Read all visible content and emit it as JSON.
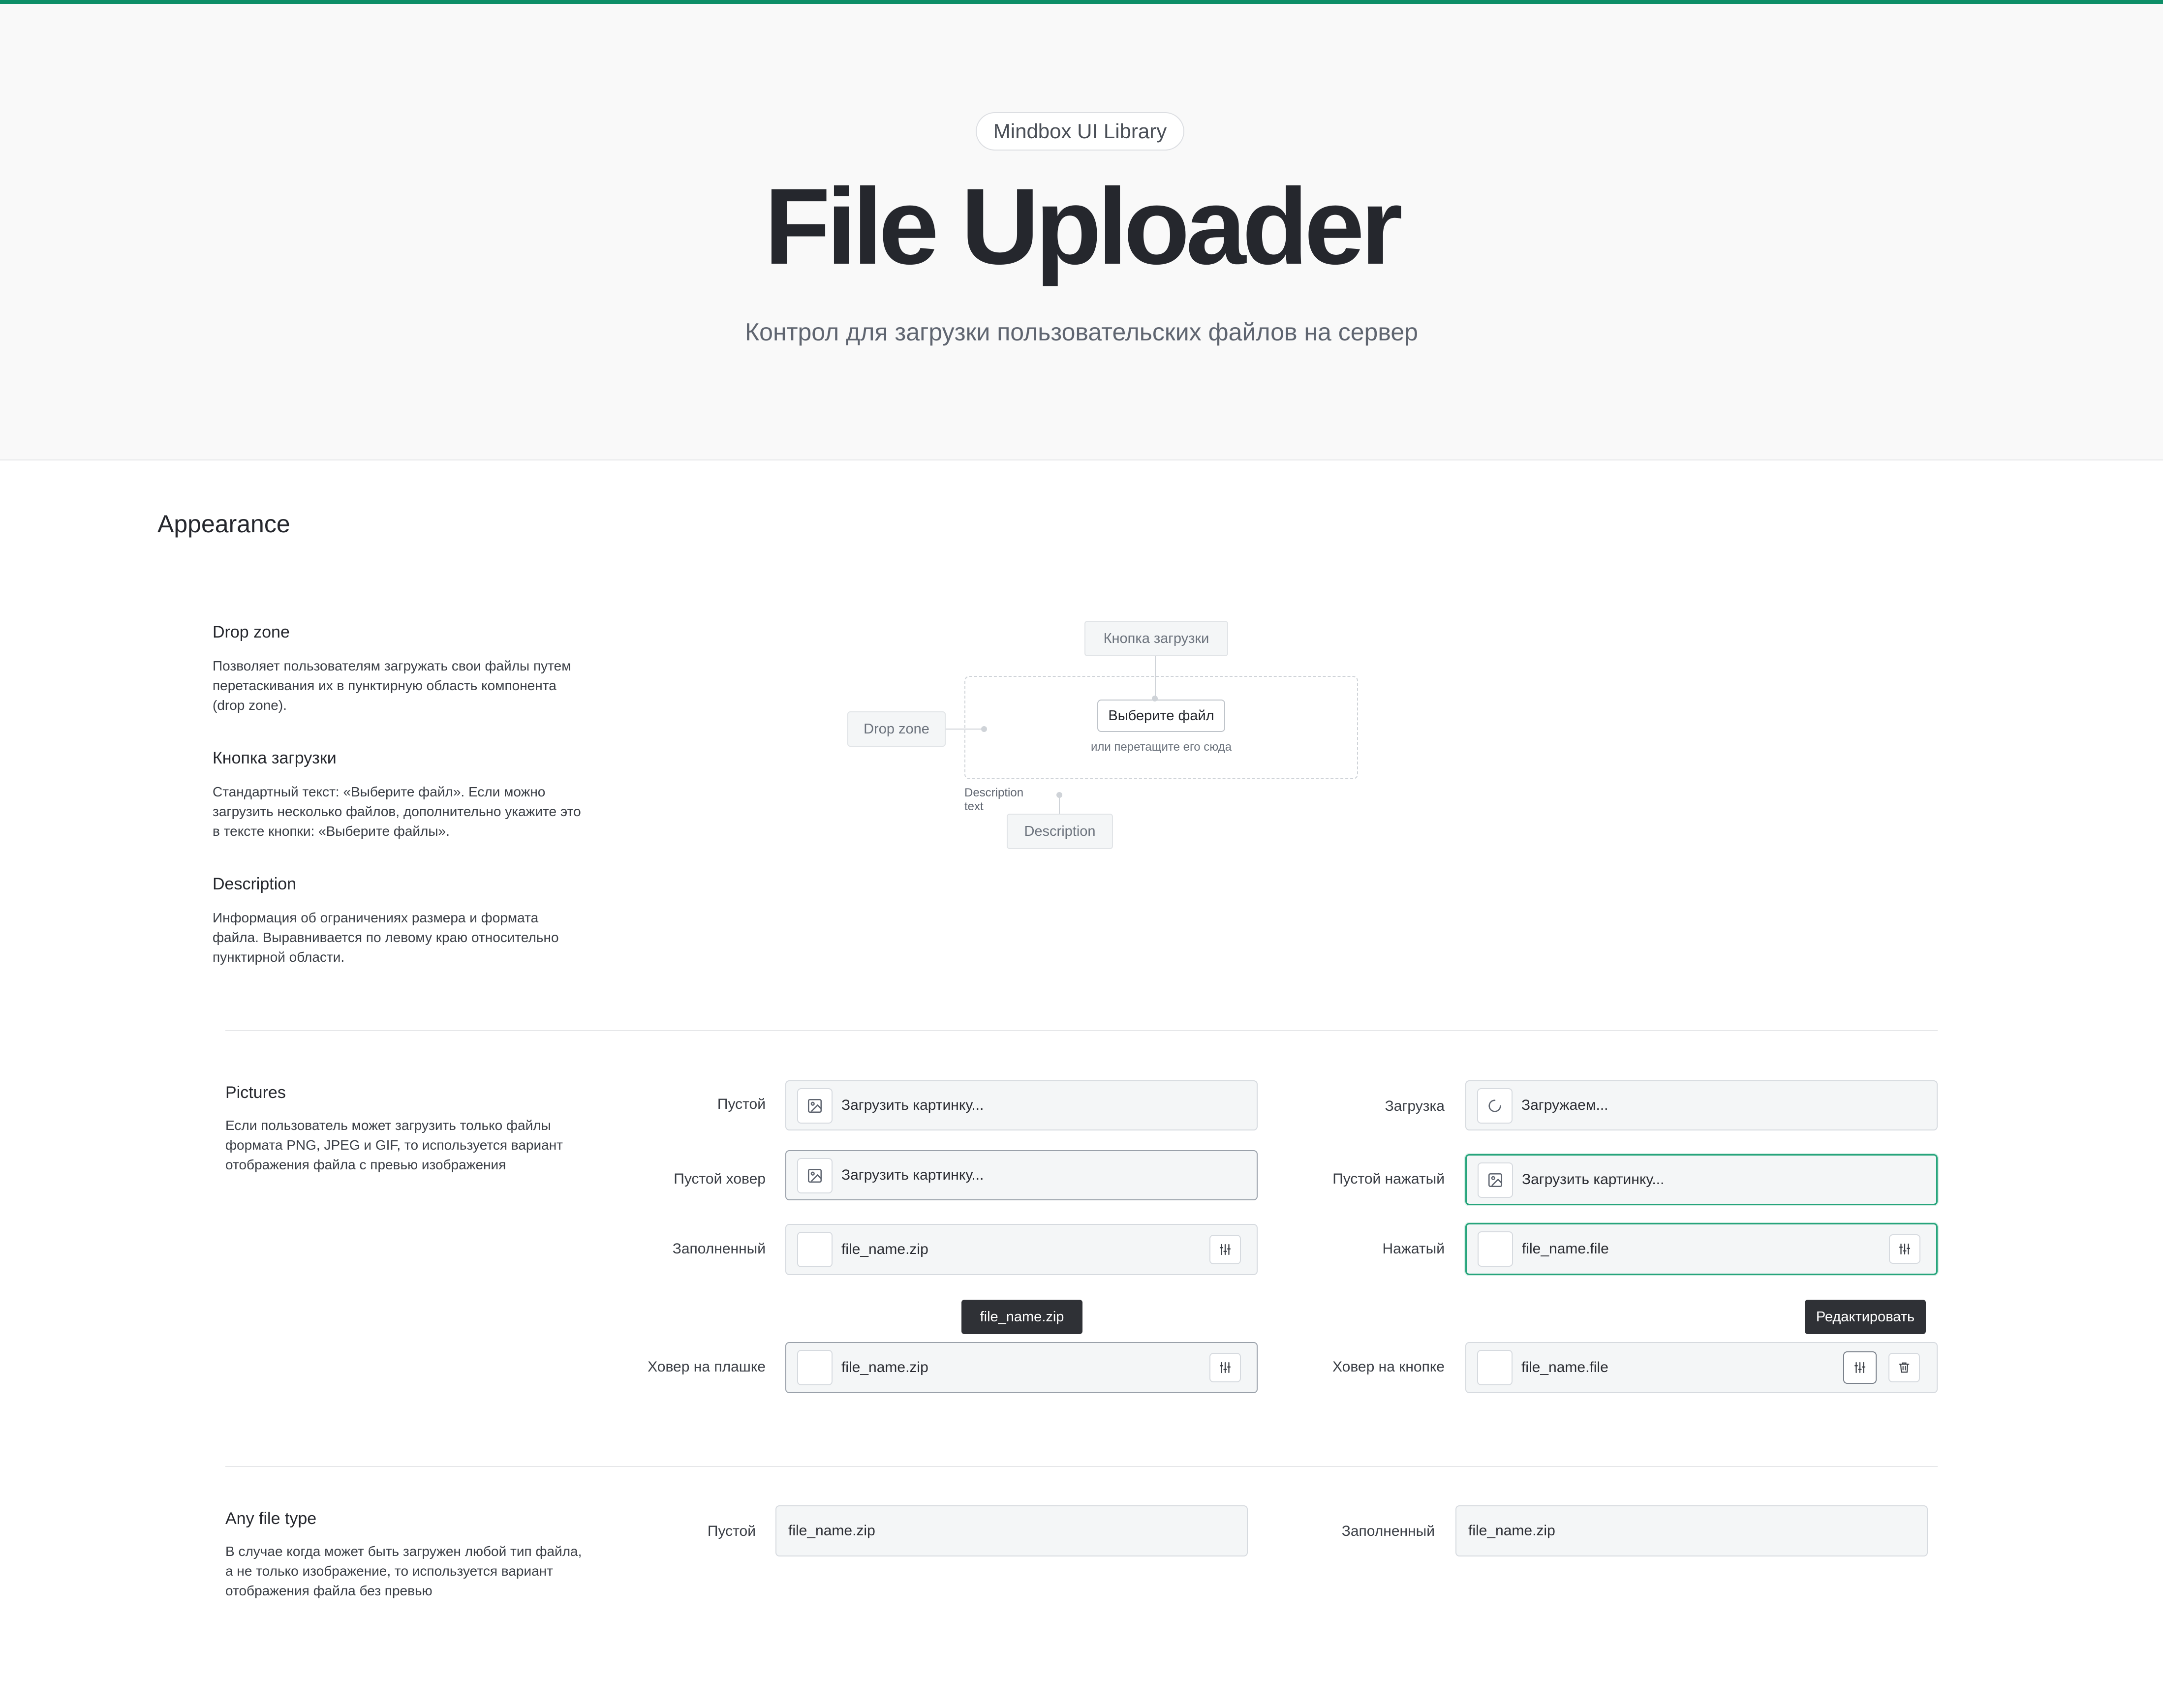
{
  "header": {
    "badge": "Mindbox UI Library",
    "title": "File Uploader",
    "subtitle": "Контрол для загрузки пользовательских файлов на сервер"
  },
  "appearance": {
    "title": "Appearance",
    "parts": [
      {
        "title": "Drop zone",
        "text": "Позволяет пользователям загружать свои файлы путем перетаскивания их в пунктирную область компонента (drop zone)."
      },
      {
        "title": "Кнопка загрузки",
        "text": "Стандартный текст: «Выберите файл». Если можно загрузить несколько файлов, дополнительно укажите это в тексте кнопки: «Выберите файлы»."
      },
      {
        "title": "Description",
        "text": "Информация об ограничениях размера и формата файла. Выравнивается по левому краю относительно пунктирной области."
      }
    ],
    "diagram": {
      "tag_button": "Кнопка загрузки",
      "tag_dropzone": "Drop zone",
      "tag_description": "Description",
      "button_label": "Выберите файл",
      "hint": "или перетащите его сюда",
      "description_text": "Description text"
    }
  },
  "pictures": {
    "title": "Pictures",
    "text": "Если пользователь может загрузить только файлы формата PNG, JPEG и GIF, то используется вариант отображения файла с превью изображения",
    "states": {
      "empty": {
        "label": "Пустой",
        "value": "Загрузить картинку..."
      },
      "loading": {
        "label": "Загрузка",
        "value": "Загружаем..."
      },
      "empty_hover": {
        "label": "Пустой ховер",
        "value": "Загрузить картинку..."
      },
      "empty_pressed": {
        "label": "Пустой нажатый",
        "value": "Загрузить картинку..."
      },
      "filled": {
        "label": "Заполненный",
        "value": "file_name.zip"
      },
      "pressed": {
        "label": "Нажатый",
        "value": "file_name.file"
      },
      "hover_plate": {
        "label": "Ховер на плашке",
        "value": "file_name.zip",
        "tooltip": "file_name.zip"
      },
      "hover_button": {
        "label": "Ховер на кнопке",
        "value": "file_name.file",
        "tooltip": "Редактировать"
      }
    }
  },
  "any_file": {
    "title": "Any file type",
    "text": "В случае когда может быть загружен любой тип файла, а не только изображение, то используется вариант отображения файла без превью",
    "states": {
      "empty": {
        "label": "Пустой",
        "value": "file_name.zip"
      },
      "filled": {
        "label": "Заполненный",
        "value": "file_name.zip"
      }
    }
  },
  "colors": {
    "accent": "#0e8f68",
    "active_border": "#27a57c",
    "tooltip_bg": "#2f3136"
  },
  "icons": [
    "image-icon",
    "spinner-icon",
    "settings-sliders-icon",
    "trash-icon"
  ]
}
